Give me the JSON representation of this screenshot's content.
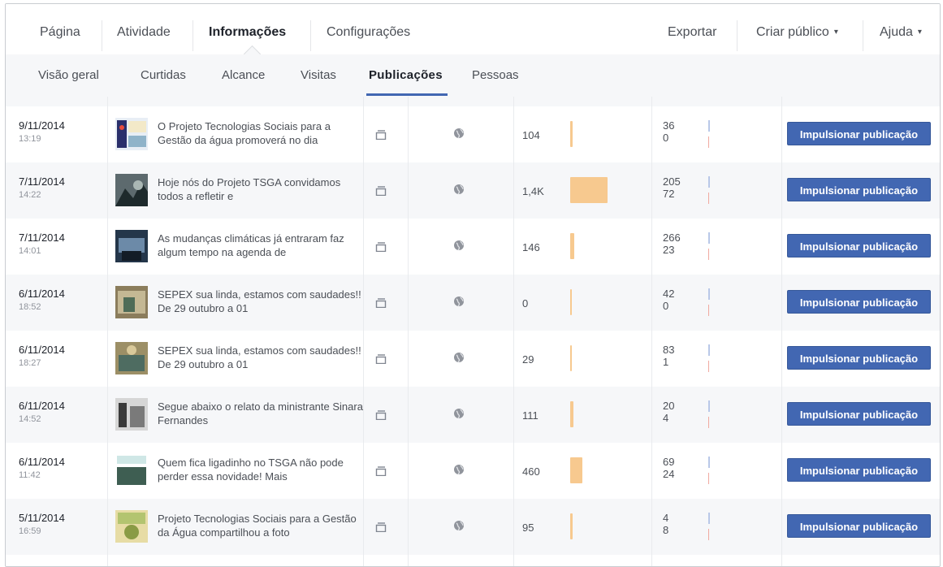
{
  "topnav": {
    "pagina": "Página",
    "atividade": "Atividade",
    "informacoes": "Informações",
    "configuracoes": "Configurações",
    "exportar": "Exportar",
    "criar_publico": "Criar público",
    "ajuda": "Ajuda",
    "caret": "▾"
  },
  "subnav": {
    "visao_geral": "Visão geral",
    "curtidas": "Curtidas",
    "alcance": "Alcance",
    "visitas": "Visitas",
    "publicacoes": "Publicações",
    "pessoas": "Pessoas"
  },
  "boost_label": "Impulsionar publicação",
  "colors": {
    "accent": "#4267b2",
    "reach_bar": "#f7c98f",
    "engagement_clicks": "#b9c8e8",
    "engagement_reactions": "#f1a9a0"
  },
  "posts": [
    {
      "date": "9/11/2014",
      "time": "13:19",
      "title": "O Projeto Tecnologias Sociais para a Gestão da água promoverá no dia",
      "type": "post-icon",
      "audience": "globe-icon",
      "reach": "104",
      "reach_value": 104,
      "eng1": "36",
      "eng2": "0"
    },
    {
      "date": "7/11/2014",
      "time": "14:22",
      "title": "Hoje nós do Projeto TSGA convidamos todos a refletir e",
      "type": "post-icon",
      "audience": "globe-icon",
      "reach": "1,4K",
      "reach_value": 1400,
      "eng1": "205",
      "eng2": "72"
    },
    {
      "date": "7/11/2014",
      "time": "14:01",
      "title": "As mudanças climáticas já entraram faz algum tempo na agenda de",
      "type": "post-icon",
      "audience": "globe-icon",
      "reach": "146",
      "reach_value": 146,
      "eng1": "266",
      "eng2": "23"
    },
    {
      "date": "6/11/2014",
      "time": "18:52",
      "title": "SEPEX sua linda, estamos com saudades!! De 29 outubro a 01",
      "type": "post-icon",
      "audience": "globe-icon",
      "reach": "0",
      "reach_value": 0,
      "eng1": "42",
      "eng2": "0"
    },
    {
      "date": "6/11/2014",
      "time": "18:27",
      "title": "SEPEX sua linda, estamos com saudades!! De 29 outubro a 01",
      "type": "post-icon",
      "audience": "globe-icon",
      "reach": "29",
      "reach_value": 29,
      "eng1": "83",
      "eng2": "1"
    },
    {
      "date": "6/11/2014",
      "time": "14:52",
      "title": "Segue abaixo o relato da ministrante Sinara Fernandes",
      "type": "post-icon",
      "audience": "globe-icon",
      "reach": "111",
      "reach_value": 111,
      "eng1": "20",
      "eng2": "4"
    },
    {
      "date": "6/11/2014",
      "time": "11:42",
      "title": "Quem fica ligadinho no TSGA não pode perder essa novidade! Mais",
      "type": "post-icon",
      "audience": "globe-icon",
      "reach": "460",
      "reach_value": 460,
      "eng1": "69",
      "eng2": "24"
    },
    {
      "date": "5/11/2014",
      "time": "16:59",
      "title": "Projeto Tecnologias Sociais para a Gestão da Água compartilhou a foto",
      "type": "post-icon",
      "audience": "globe-icon",
      "reach": "95",
      "reach_value": 95,
      "eng1": "4",
      "eng2": "8"
    }
  ]
}
